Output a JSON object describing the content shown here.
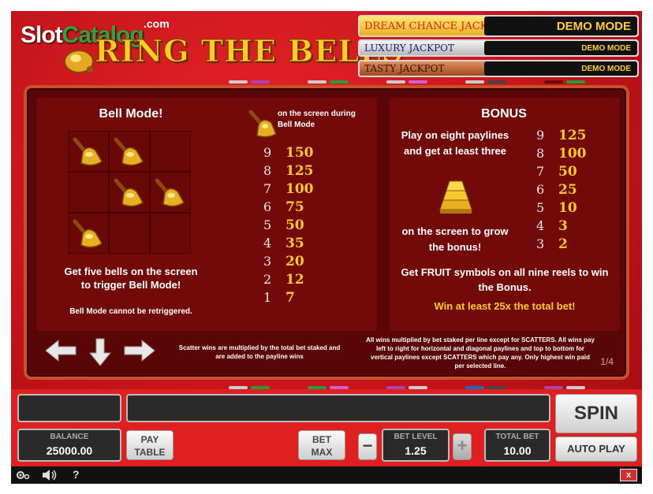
{
  "logo": {
    "slot": "Slot",
    "catalog": "Catalog",
    "com": ".com",
    "title": "RING THE BELLS"
  },
  "jackpots": [
    {
      "name": "DREAM CHANCE JACKPOT",
      "value": "DEMO MODE"
    },
    {
      "name": "LUXURY JACKPOT",
      "value": "DEMO MODE"
    },
    {
      "name": "TASTY JACKPOT",
      "value": "DEMO MODE"
    }
  ],
  "bell_mode": {
    "title": "Bell Mode!",
    "grid_bells": [
      true,
      true,
      false,
      false,
      true,
      true,
      true,
      false,
      false
    ],
    "description": "Get five bells on the screen to trigger Bell Mode!",
    "note": "Bell Mode cannot be retriggered.",
    "symbol_caption": "on the screen during Bell Mode",
    "pays": [
      {
        "count": "9",
        "value": "150"
      },
      {
        "count": "8",
        "value": "125"
      },
      {
        "count": "7",
        "value": "100"
      },
      {
        "count": "6",
        "value": "75"
      },
      {
        "count": "5",
        "value": "50"
      },
      {
        "count": "4",
        "value": "35"
      },
      {
        "count": "3",
        "value": "20"
      },
      {
        "count": "2",
        "value": "12"
      },
      {
        "count": "1",
        "value": "7"
      }
    ]
  },
  "bonus": {
    "title": "BONUS",
    "text_top": "Play on eight paylines and get at least three",
    "text_bottom": "on the screen to grow the bonus!",
    "pays": [
      {
        "count": "9",
        "value": "125"
      },
      {
        "count": "8",
        "value": "100"
      },
      {
        "count": "7",
        "value": "50"
      },
      {
        "count": "6",
        "value": "25"
      },
      {
        "count": "5",
        "value": "10"
      },
      {
        "count": "4",
        "value": "3"
      },
      {
        "count": "3",
        "value": "2"
      }
    ],
    "fruit_text": "Get FRUIT symbols on all nine reels to win the Bonus.",
    "win_text": "Win at least 25x the total bet!"
  },
  "footnotes": {
    "scatter": "Scatter wins are multiplied by the total bet staked and are added to the payline wins",
    "rules": "All wins multiplied by bet staked per line except for SCATTERS. All wins pay left to right for horizontal and diagonal paylines and top to bottom for vertical paylines except SCATTERS which pay any. Only highest win paid per selected line."
  },
  "page_indicator": "1/4",
  "controls": {
    "spin": "SPIN",
    "balance_label": "BALANCE",
    "balance_value": "25000.00",
    "pay_table_line1": "PAY",
    "pay_table_line2": "TABLE",
    "bet_max_line1": "BET",
    "bet_max_line2": "MAX",
    "minus": "−",
    "bet_level_label": "BET LEVEL",
    "bet_level_value": "1.25",
    "plus": "+",
    "total_bet_label": "TOTAL BET",
    "total_bet_value": "10.00",
    "auto_play": "AUTO PLAY",
    "help": "?",
    "close": "x"
  }
}
